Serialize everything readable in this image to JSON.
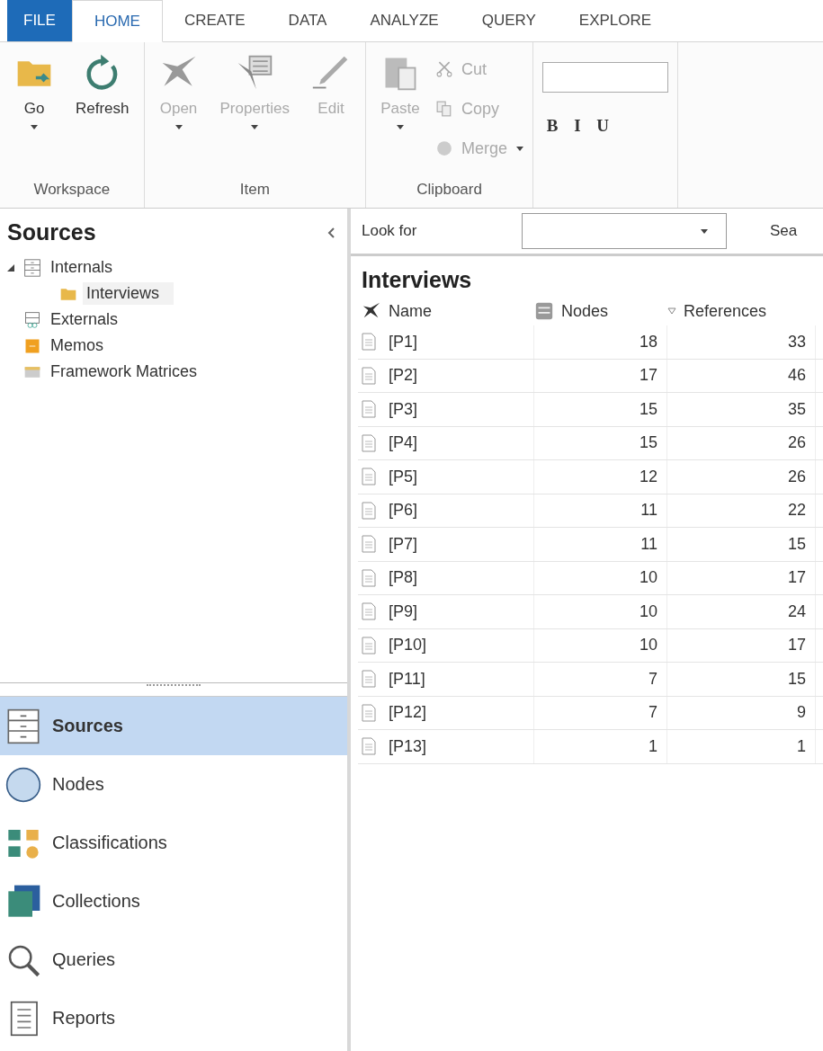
{
  "tabs": [
    {
      "label": "FILE",
      "kind": "file",
      "selected": false
    },
    {
      "label": "HOME",
      "kind": "tab",
      "selected": true
    },
    {
      "label": "CREATE",
      "kind": "tab",
      "selected": false
    },
    {
      "label": "DATA",
      "kind": "tab",
      "selected": false
    },
    {
      "label": "ANALYZE",
      "kind": "tab",
      "selected": false
    },
    {
      "label": "QUERY",
      "kind": "tab",
      "selected": false
    },
    {
      "label": "EXPLORE",
      "kind": "tab",
      "selected": false
    }
  ],
  "ribbon": {
    "groups": [
      {
        "label": "Workspace",
        "items": [
          {
            "kind": "large",
            "label": "Go",
            "disabled": false,
            "dropdown": true
          },
          {
            "kind": "large",
            "label": "Refresh",
            "disabled": false,
            "dropdown": false
          }
        ]
      },
      {
        "label": "Item",
        "items": [
          {
            "kind": "large",
            "label": "Open",
            "disabled": true,
            "dropdown": true
          },
          {
            "kind": "large",
            "label": "Properties",
            "disabled": true,
            "dropdown": true
          },
          {
            "kind": "large",
            "label": "Edit",
            "disabled": true,
            "dropdown": false
          }
        ]
      },
      {
        "label": "Clipboard",
        "items": [
          {
            "kind": "large",
            "label": "Paste",
            "disabled": true,
            "dropdown": true
          },
          {
            "kind": "small",
            "label": "Cut",
            "disabled": true,
            "dropdown": false
          },
          {
            "kind": "small",
            "label": "Copy",
            "disabled": true,
            "dropdown": false
          },
          {
            "kind": "small",
            "label": "Merge",
            "disabled": true,
            "dropdown": true
          }
        ]
      },
      {
        "items": [
          {
            "kind": "field"
          },
          {
            "kind": "format",
            "label": "B"
          },
          {
            "kind": "format",
            "label": "I"
          },
          {
            "kind": "format",
            "label": "U"
          }
        ]
      }
    ]
  },
  "sidebar": {
    "title": "Sources",
    "tree": [
      {
        "label": "Internals",
        "expanded": true,
        "selected": false,
        "children": [
          {
            "label": "Interviews",
            "selected": true
          }
        ]
      },
      {
        "label": "Externals",
        "selected": false
      },
      {
        "label": "Memos",
        "selected": false
      },
      {
        "label": "Framework Matrices",
        "selected": false
      }
    ]
  },
  "navigation": [
    {
      "label": "Sources",
      "selected": true
    },
    {
      "label": "Nodes",
      "selected": false
    },
    {
      "label": "Classifications",
      "selected": false
    },
    {
      "label": "Collections",
      "selected": false
    },
    {
      "label": "Queries",
      "selected": false
    },
    {
      "label": "Reports",
      "selected": false
    }
  ],
  "search": {
    "label": "Look for",
    "button": "Sea"
  },
  "table": {
    "title": "Interviews",
    "columns": [
      "Name",
      "Nodes",
      "References"
    ],
    "rows": [
      [
        "[P1]",
        "18",
        "33"
      ],
      [
        "[P2]",
        "17",
        "46"
      ],
      [
        "[P3]",
        "15",
        "35"
      ],
      [
        "[P4]",
        "15",
        "26"
      ],
      [
        "[P5]",
        "12",
        "26"
      ],
      [
        "[P6]",
        "11",
        "22"
      ],
      [
        "[P7]",
        "11",
        "15"
      ],
      [
        "[P8]",
        "10",
        "17"
      ],
      [
        "[P9]",
        "10",
        "24"
      ],
      [
        "[P10]",
        "10",
        "17"
      ],
      [
        "[P11]",
        "7",
        "15"
      ],
      [
        "[P12]",
        "7",
        "9"
      ],
      [
        "[P13]",
        "1",
        "1"
      ]
    ]
  }
}
